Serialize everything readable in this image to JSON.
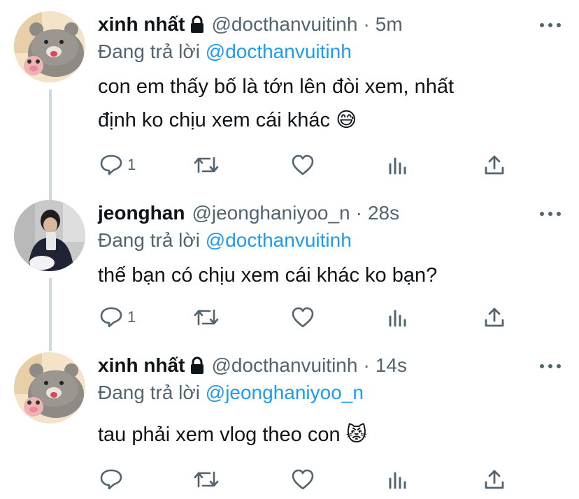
{
  "colors": {
    "text": "#0f1419",
    "secondary": "#536471",
    "link": "#1d9bf0",
    "thread_line": "#cfd9de"
  },
  "tweets": [
    {
      "name": "xinh nhất",
      "locked": true,
      "handle": "@docthanvuitinh",
      "separator": "·",
      "time": "5m",
      "reply_prefix": "Đang trả lời",
      "reply_to": "@docthanvuitinh",
      "lines": [
        "con em thấy bố là tớn lên đòi xem, nhất",
        "định ko chịu xem cái khác"
      ],
      "emoji": "😅",
      "reply_count": "1",
      "avatar_icon": "bear-avatar-icon"
    },
    {
      "name": "jeonghan",
      "locked": false,
      "handle": "@jeonghaniyoo_n",
      "separator": "·",
      "time": "28s",
      "reply_prefix": "Đang trả lời",
      "reply_to": "@docthanvuitinh",
      "lines": [
        "thế bạn có chịu xem cái khác ko bạn?"
      ],
      "reply_count": "1",
      "avatar_icon": "person-photo-avatar-icon"
    },
    {
      "name": "xinh nhất",
      "locked": true,
      "handle": "@docthanvuitinh",
      "separator": "·",
      "time": "14s",
      "reply_prefix": "Đang trả lời",
      "reply_to": "@jeonghaniyoo_n",
      "lines": [
        "tau phải xem vlog theo con"
      ],
      "emoji": "😾",
      "reply_count": "",
      "avatar_icon": "bear-avatar-icon"
    }
  ],
  "icons": {
    "lock": "lock-icon",
    "more": "more-icon",
    "reply": "reply-icon",
    "retweet": "retweet-icon",
    "like": "like-icon",
    "views": "views-icon",
    "share": "share-icon"
  }
}
